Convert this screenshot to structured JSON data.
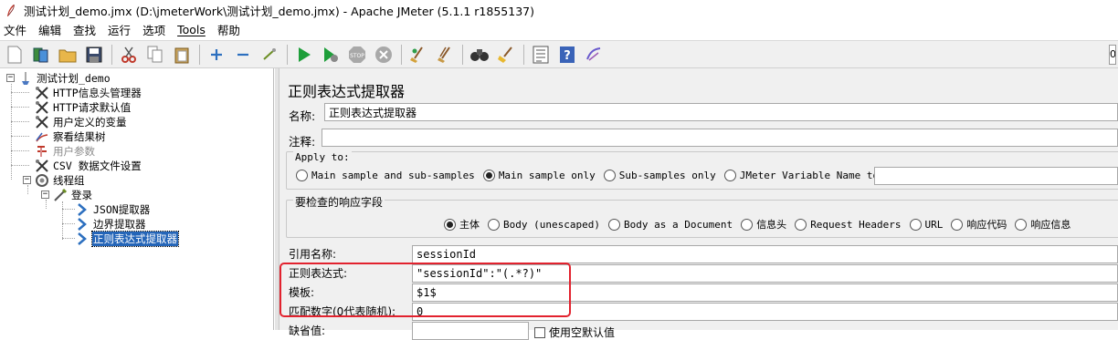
{
  "window": {
    "title": "测试计划_demo.jmx (D:\\jmeterWork\\测试计划_demo.jmx) - Apache JMeter (5.1.1 r1855137)"
  },
  "menu": [
    "文件",
    "编辑",
    "查找",
    "运行",
    "选项",
    "Tools",
    "帮助"
  ],
  "toolbar": {
    "icons": [
      "new-icon",
      "templates-icon",
      "open-icon",
      "save-icon",
      "cut-icon",
      "copy-icon",
      "paste-icon",
      "expand-icon",
      "collapse-icon",
      "toggle-icon",
      "start-icon",
      "start-no-pause-icon",
      "stop-icon",
      "shutdown-icon",
      "clear-icon",
      "clear-all-icon",
      "search-icon",
      "reset-search-icon",
      "function-helper-icon",
      "help-icon",
      "remote-icon"
    ],
    "right_clip": "0"
  },
  "tree": {
    "items": [
      {
        "label": "测试计划_demo",
        "icon": "test-plan-icon"
      },
      {
        "label": "HTTP信息头管理器",
        "icon": "config-wrench-icon"
      },
      {
        "label": "HTTP请求默认值",
        "icon": "config-wrench-icon"
      },
      {
        "label": "用户定义的变量",
        "icon": "config-wrench-icon"
      },
      {
        "label": "察看结果树",
        "icon": "listener-icon"
      },
      {
        "label": "用户参数",
        "icon": "preprocessor-icon"
      },
      {
        "label": "CSV 数据文件设置",
        "icon": "config-wrench-icon"
      },
      {
        "label": "线程组",
        "icon": "thread-group-icon"
      },
      {
        "label": "登录",
        "icon": "sampler-pipette-icon"
      },
      {
        "label": "JSON提取器",
        "icon": "extractor-arrow-icon"
      },
      {
        "label": "边界提取器",
        "icon": "extractor-arrow-icon"
      },
      {
        "label": "正则表达式提取器",
        "icon": "extractor-arrow-icon"
      }
    ]
  },
  "panel": {
    "title": "正则表达式提取器",
    "name_label": "名称:",
    "name_value": "正则表达式提取器",
    "comment_label": "注释:",
    "comment_value": "",
    "apply_to": {
      "title": "Apply to:",
      "options": [
        "Main sample and sub-samples",
        "Main sample only",
        "Sub-samples only",
        "JMeter Variable Name to use"
      ],
      "selected": "Main sample only",
      "var_value": ""
    },
    "field_check": {
      "title": "要检查的响应字段",
      "options": [
        "主体",
        "Body (unescaped)",
        "Body as a Document",
        "信息头",
        "Request Headers",
        "URL",
        "响应代码",
        "响应信息"
      ],
      "selected": "主体"
    },
    "ref_name_label": "引用名称:",
    "ref_name_value": "sessionId",
    "regex_label": "正则表达式:",
    "regex_value": "\"sessionId\":\"(.*?)\"",
    "template_label": "模板:",
    "template_value": "$1$",
    "match_label": "匹配数字(0代表随机):",
    "match_value": "0",
    "default_label": "缺省值:",
    "default_check_label": "使用空默认值"
  },
  "colors": {
    "selection": "#2465b8",
    "highlight_box": "#e2222e",
    "panel_bg": "#f0f0f0"
  }
}
